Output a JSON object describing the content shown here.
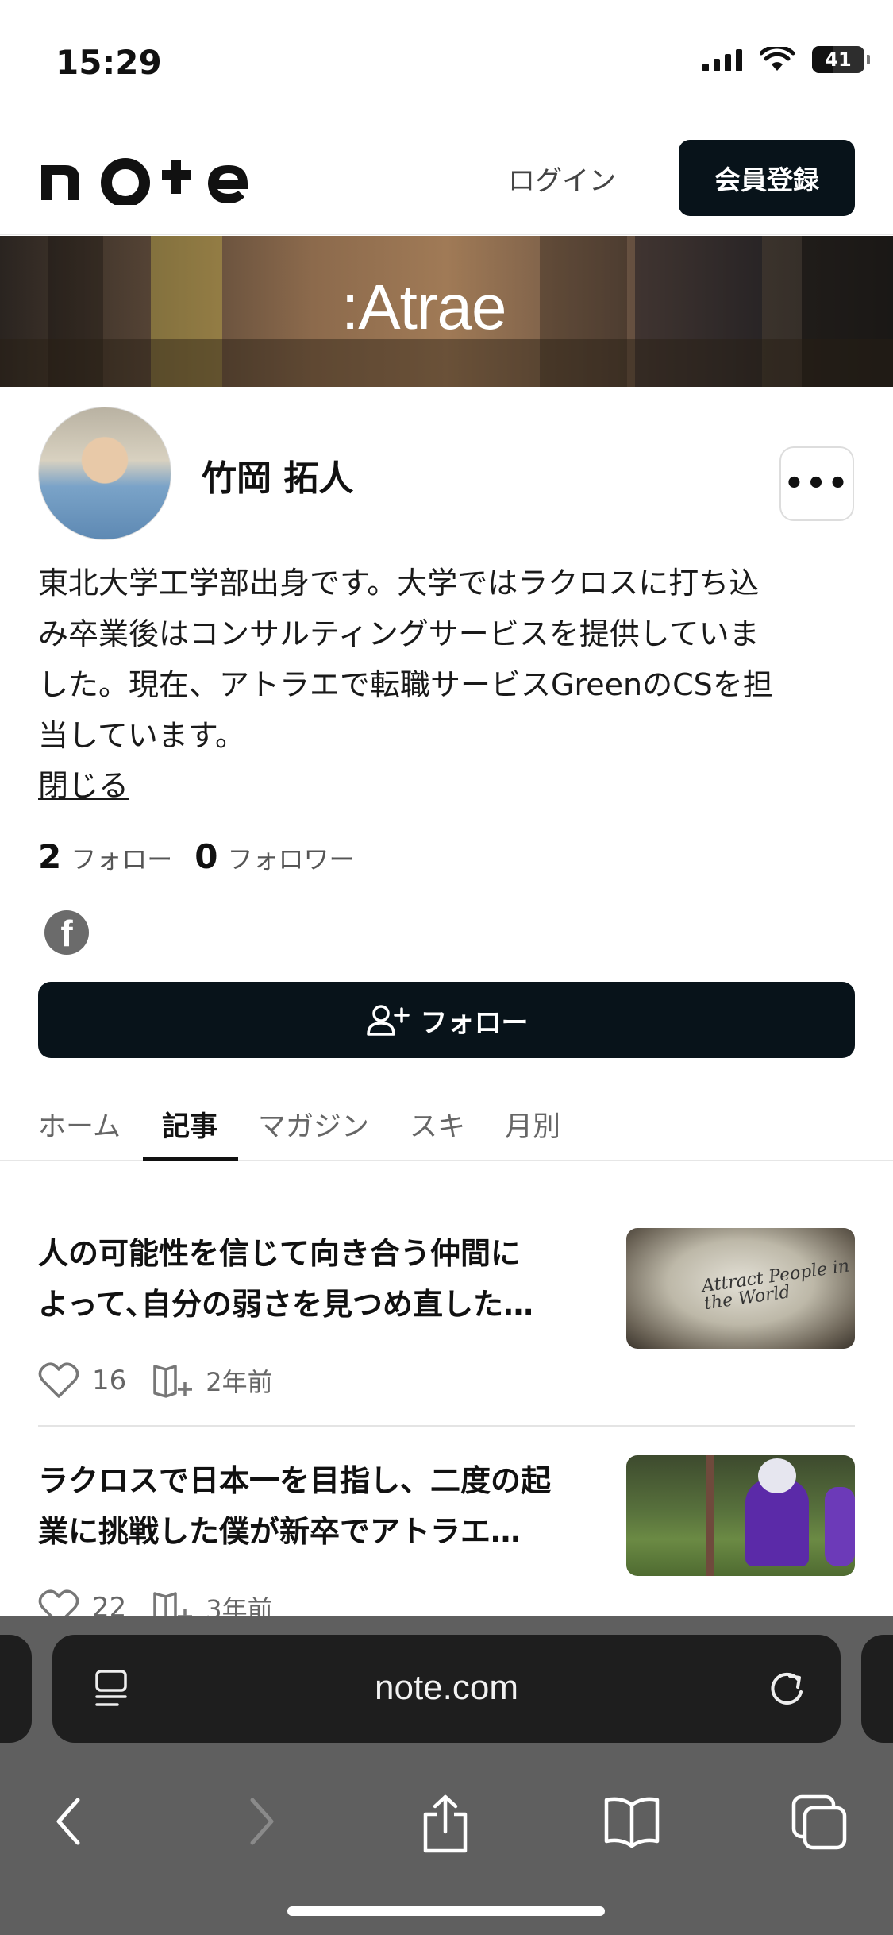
{
  "status_bar": {
    "time": "15:29",
    "battery": "41",
    "battery_level_percent": 41
  },
  "header": {
    "logo": "note",
    "login_label": "ログイン",
    "signup_label": "会員登録"
  },
  "banner": {
    "brand": ":Atrae"
  },
  "profile": {
    "name": "竹岡 拓人",
    "more_label": "•••",
    "bio_lines": [
      "東北大学工学部出身です。大学ではラクロスに打ち込",
      "み卒業後はコンサルティングサービスを提供していま",
      "した。現在、アトラエで転職サービスGreenのCSを担",
      "当しています。"
    ],
    "close_label": "閉じる",
    "following_count": "2",
    "following_label": "フォロー",
    "followers_count": "0",
    "followers_label": "フォロワー",
    "follow_button_label": "フォロー"
  },
  "tabs": [
    {
      "label": "ホーム",
      "active": false
    },
    {
      "label": "記事",
      "active": true
    },
    {
      "label": "マガジン",
      "active": false
    },
    {
      "label": "スキ",
      "active": false
    },
    {
      "label": "月別",
      "active": false
    }
  ],
  "articles": [
    {
      "title_lines": [
        "人の可能性を信じて向き合う仲間に",
        "よって､自分の弱さを見つめ直した…"
      ],
      "likes": "16",
      "date": "2年前",
      "thumb_text": "Attract People in the World"
    },
    {
      "title_lines": [
        "ラクロスで日本一を目指し、二度の起",
        "業に挑戦した僕が新卒でアトラエ…"
      ],
      "likes": "22",
      "date": "3年前"
    }
  ],
  "browser": {
    "url": "note.com"
  },
  "colors": {
    "primary_button": "#08131a",
    "toolbar_bg": "#5f5f5f",
    "urlbar_bg": "#1e1e1e"
  }
}
